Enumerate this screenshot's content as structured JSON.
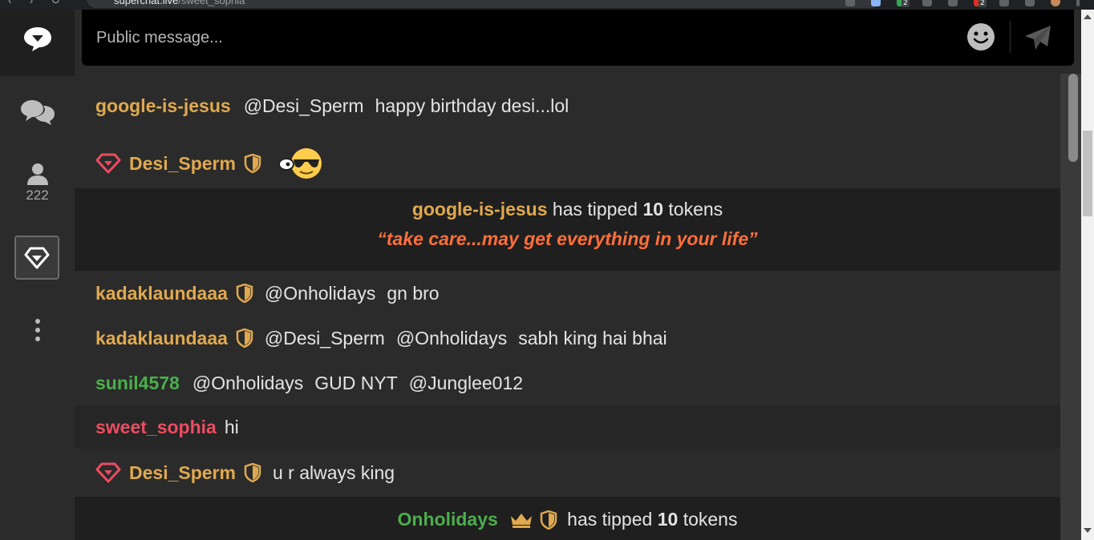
{
  "browser": {
    "url_host": "superchat.live",
    "url_path": "/sweet_sophia",
    "ext_badge_1": "2",
    "ext_badge_2": "2"
  },
  "sidebar": {
    "viewer_count": "222"
  },
  "composer": {
    "placeholder": "Public message..."
  },
  "messages": [
    {
      "user": "google-is-jesus",
      "mention": "@Desi_Sperm",
      "text": "happy birthday desi...lol"
    },
    {
      "user": "Desi_Sperm",
      "text": ""
    },
    {
      "user": "kadaklaundaaa",
      "mention": "@Onholidays",
      "text": "gn bro"
    },
    {
      "user": "kadaklaundaaa",
      "mention": "@Desi_Sperm",
      "mention2": "@Onholidays",
      "text": "sabh king hai bhai"
    },
    {
      "user": "sunil4578",
      "mention": "@Onholidays",
      "text": "GUD NYT",
      "mention2": "@Junglee012"
    },
    {
      "user": "sweet_sophia",
      "text": "hi"
    },
    {
      "user": "Desi_Sperm",
      "text": "u r always king"
    }
  ],
  "tips": [
    {
      "user": "google-is-jesus",
      "pre": "has tipped",
      "amount": "10",
      "post": "tokens",
      "note": "“take care...may get everything in your life”"
    },
    {
      "user": "Onholidays",
      "pre": "has tipped",
      "amount": "10",
      "post": "tokens"
    }
  ],
  "colors": {
    "gold_user": "#e0a94f",
    "green_user": "#4cae4c",
    "red_user": "#ec4c60",
    "tip_note": "#ff6f3c"
  }
}
